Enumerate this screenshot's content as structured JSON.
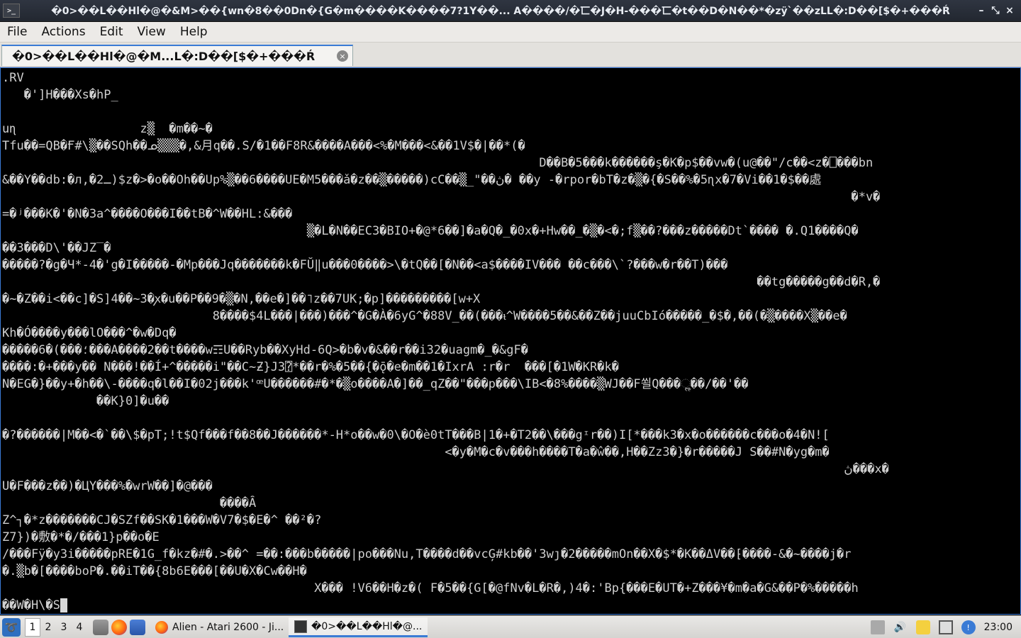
{
  "window": {
    "title": "�0>��L��Hl�@�&M>��{wn�8��0Dn�{G�m����K����7?1Y��...  A����/�⼖�J�H-���⼖�t��D�N��*�zÿ`��zLL�:D��[$�+���Ŕ",
    "app_icon_label": ">_",
    "minimize_label": "–",
    "restore_label": "⤡",
    "close_label": "×"
  },
  "menu": {
    "items": [
      "File",
      "Actions",
      "Edit",
      "View",
      "Help"
    ]
  },
  "tab": {
    "label": "�0>��L��Hl�@�M...L�:D��[$�+���Ŕ",
    "close_label": "×"
  },
  "terminal": {
    "lines": [
      {
        "text": ".RV"
      },
      {
        "text": "   �']H���Xs�hP_"
      },
      {
        "text": ""
      },
      {
        "text": "uɳ                 z▒  �m��~�"
      },
      {
        "text": "Tfu��=QB�Ғ#\\▒��SQh��ᓄ▒▒▒�,&⽉q��.S/�1��F8R&����A���<%�M���<&��1V$�|��*(�"
      },
      {
        "text": "                                                                          D��B�5���k������ş�K�p$��vw�(u@��\"/c��<z�⎕���bn"
      },
      {
        "text": "&��Y��db:�л,�2ـ)$z�>�o��Oh��Up%▒��6����UE�M5���ǎ�z��▒�����)cC��▒_\"��ڽ� ��y -�rpor�bT�z�▒�{�S��%�5ɳx�7�Vi��1�$��處"
      },
      {
        "text": "                                                                                                                     �*v�"
      },
      {
        "text": "=�ʲ���K�'�N�3a^����O���I��tB�^W��HL:&���"
      },
      {
        "text": "                                          ▒�L�N��EC3�BIO+�@*6��]�a�Q�_�0x�+Hw��_�▒�<�;f▒��?���z�����Dt`���� �.Q1����Q�"
      },
      {
        "text": "��3���D\\'��JZ‾�"
      },
      {
        "text": "�����?�g�Ч*-4�'g�I�����-�Mp���Jq�������k�FŬ‖u���0����>\\�tQ��[�N��<a$����IV��� ��c���\\`?���w�r��T)���"
      },
      {
        "text": "                                                                                                        ��tg�����g��d�R,�"
      },
      {
        "text": "�~�Z��i<��c]�S]4��~3�ꭗ�u��P��9�▒�N,��e�]��˥z��7UK;�p]���������[w+X"
      },
      {
        "text": "                             8����$4L���|���)���^�G�À�6yG^�88V_��(���ᵼ^W����5��&��Z��juuCbIó�����_�$�,��(�▒����X▒��e�"
      },
      {
        "text": "Kh�Ó����y���lO���^�w�Dq�"
      },
      {
        "text": "�����6�(���؛���A����2��t����w☶U��Ryb��XyHd-6Q>�b�v�&��r��i32�uagm�_�&gF�"
      },
      {
        "text": "����:�+���y�� N���!��Í+^�����i\"��C~Ƶ}J3⍰*��r�%�5��{�ǭ�e�m��1�IxrA :r�r  ���[�1W�KR�k�"
      },
      {
        "text": "N�EG�}��y+�h��\\-����q�l��I�02j���k'ꟹU������#�*�▒o����A�]��_qZ��\"���p���\\IB<�8%����▒WJ��F쐴Q���ૢ��/��'��"
      },
      {
        "text": "             ��K}0]�u��"
      },
      {
        "text": ""
      },
      {
        "text": "�?������|M��<�`��\\$�pT;!t$Qf���f��8��J������*-H*o��w�0\\�O�è0tT���B|1�+�T2��\\���gᶦr��)I[*���k3�x�o������c���o�4�N!["
      },
      {
        "text": "                                                             <�y�M�c�v���h����T�a�ŵ��,H��Zz3�}�r�����J S��#N�yg�m�"
      },
      {
        "text": "                                                                                                                    ڽ���x�"
      },
      {
        "text": "U�F���z��)�ЦY���%�wrW��]�@���"
      },
      {
        "text": "                              ����Ȃ"
      },
      {
        "text": "Z^┐�*z�������CJ�SZf��SK�1���W�V7�$�E�^ ��²�?"
      },
      {
        "text": "Z7})�敷�*�/���1}p��o�E"
      },
      {
        "text": "/���Fÿ�y3i�����pRE�1G_f�kz�#�.>��^ =��:���b�����|po���Nu,T����d��vcĢ#kb��'3wȷ�2�����mOn��X�$*�K��ΔV��⁅����-&�~����j�r"
      },
      {
        "text": "�.▒b�[����boP�.��iT��{8b6E���[��U�X�Cw��H�"
      },
      {
        "text": "                                           X��� !V6��H�z�( F�5��{G[�@fNv�L�R�,)4�:'Bp{���E�UT�+Z���¥�m�a�G&��P�%�����h"
      },
      {
        "text": "��W�H\\�S",
        "cursor": true
      }
    ]
  },
  "taskbar": {
    "desktops": [
      "1",
      "2",
      "3",
      "4"
    ],
    "tasks": [
      {
        "label": "Alien - Atari 2600 - Ji...",
        "icon": "firefox-icon"
      },
      {
        "label": "�0>��L��Hl�@...",
        "icon": "terminal-icon"
      }
    ],
    "clock": "23:00"
  },
  "colors": {
    "terminal_bg": "#000000",
    "terminal_fg": "#cfcfcf",
    "accent": "#3a7bd5",
    "titlebar_bg": "#262b34",
    "menubar_bg": "#eceae7"
  }
}
